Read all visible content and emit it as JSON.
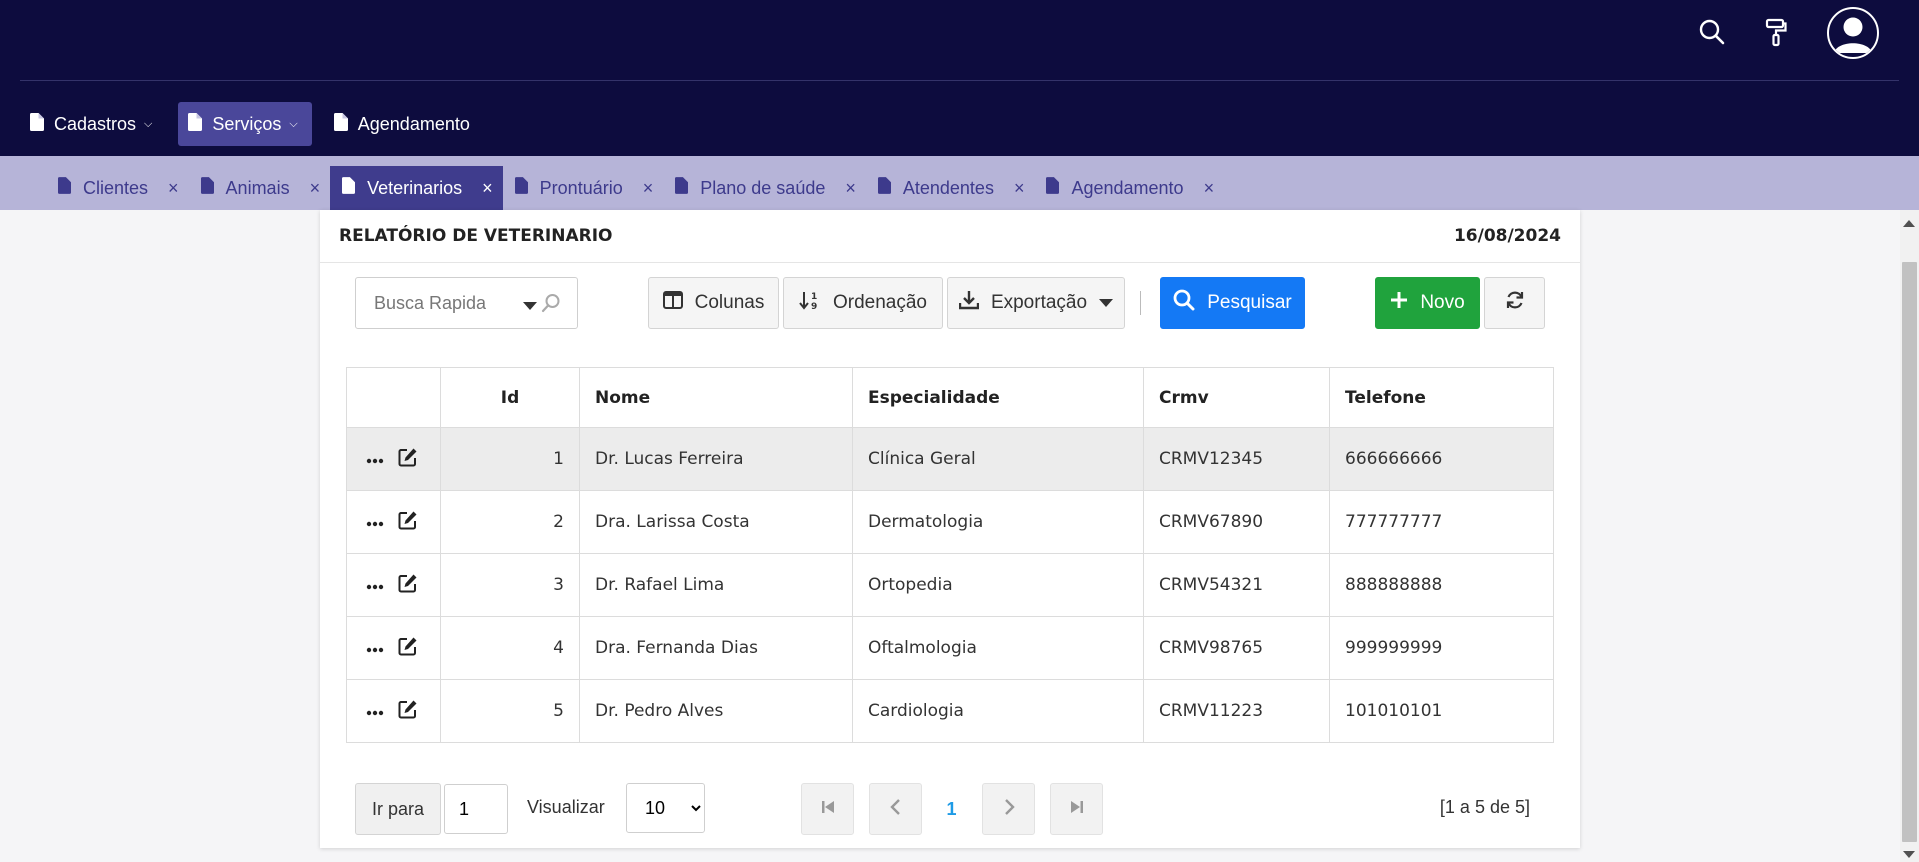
{
  "header": {
    "icons": [
      "search-icon",
      "paint-roller-icon",
      "user-avatar-icon"
    ]
  },
  "menu": [
    {
      "label": "Cadastros",
      "icon": "file-icon",
      "has_dropdown": true,
      "active": false
    },
    {
      "label": "Serviços",
      "icon": "file-icon",
      "has_dropdown": true,
      "active": true
    },
    {
      "label": "Agendamento",
      "icon": "file-icon",
      "has_dropdown": false,
      "active": false
    }
  ],
  "tabs": [
    {
      "label": "Clientes",
      "active": false
    },
    {
      "label": "Animais",
      "active": false
    },
    {
      "label": "Veterinarios",
      "active": true
    },
    {
      "label": "Prontuário",
      "active": false
    },
    {
      "label": "Plano de saúde",
      "active": false
    },
    {
      "label": "Atendentes",
      "active": false
    },
    {
      "label": "Agendamento",
      "active": false
    }
  ],
  "report": {
    "title": "RELATÓRIO DE VETERINARIO",
    "date": "16/08/2024"
  },
  "toolbar": {
    "search_placeholder": "Busca Rapida",
    "columns_label": "Colunas",
    "sort_label": "Ordenação",
    "export_label": "Exportação",
    "search_button_label": "Pesquisar",
    "new_button_label": "Novo"
  },
  "table": {
    "headers": [
      "Id",
      "Nome",
      "Especialidade",
      "Crmv",
      "Telefone"
    ],
    "rows": [
      {
        "id": "1",
        "nome": "Dr. Lucas Ferreira",
        "especialidade": "Clínica Geral",
        "crmv": "CRMV12345",
        "telefone": "666666666"
      },
      {
        "id": "2",
        "nome": "Dra. Larissa Costa",
        "especialidade": "Dermatologia",
        "crmv": "CRMV67890",
        "telefone": "777777777"
      },
      {
        "id": "3",
        "nome": "Dr. Rafael Lima",
        "especialidade": "Ortopedia",
        "crmv": "CRMV54321",
        "telefone": "888888888"
      },
      {
        "id": "4",
        "nome": "Dra. Fernanda Dias",
        "especialidade": "Oftalmologia",
        "crmv": "CRMV98765",
        "telefone": "999999999"
      },
      {
        "id": "5",
        "nome": "Dr. Pedro Alves",
        "especialidade": "Cardiologia",
        "crmv": "CRMV11223",
        "telefone": "101010101"
      }
    ]
  },
  "pagination": {
    "goto_label": "Ir para",
    "goto_value": "1",
    "view_label": "Visualizar",
    "page_size": "10",
    "current_page": "1",
    "range_text": "[1 a 5 de 5]"
  },
  "colors": {
    "header_bg": "#0d0c3e",
    "tabbar_bg": "#b6b4d8",
    "active_tab": "#3f3c8d",
    "primary": "#1479f5",
    "success": "#20a33d"
  }
}
